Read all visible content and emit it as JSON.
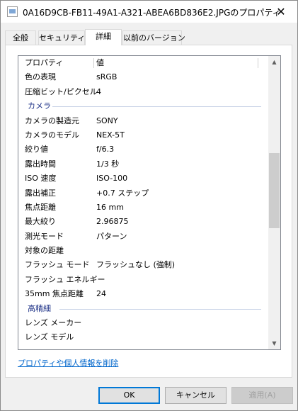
{
  "window": {
    "title": "0A16D9CB-FB11-49A1-A321-ABEA6BD836E2.JPGのプロパティ"
  },
  "tabs": [
    {
      "label": "全般"
    },
    {
      "label": "セキュリティ"
    },
    {
      "label": "詳細",
      "active": true
    },
    {
      "label": "以前のバージョン"
    }
  ],
  "details": {
    "header": {
      "name": "プロパティ",
      "value": "値"
    },
    "rows_top": [
      {
        "name": "色の表現",
        "value": "sRGB"
      },
      {
        "name": "圧縮ビット/ピクセル",
        "value": "4"
      }
    ],
    "camera_group": "カメラ",
    "camera_rows": [
      {
        "name": "カメラの製造元",
        "value": "SONY"
      },
      {
        "name": "カメラのモデル",
        "value": "NEX-5T"
      },
      {
        "name": "絞り値",
        "value": "f/6.3"
      },
      {
        "name": "露出時間",
        "value": "1/3 秒"
      },
      {
        "name": "ISO 速度",
        "value": "ISO-100"
      },
      {
        "name": "露出補正",
        "value": "+0.7 ステップ"
      },
      {
        "name": "焦点距離",
        "value": "16 mm"
      },
      {
        "name": "最大絞り",
        "value": "2.96875"
      },
      {
        "name": "測光モード",
        "value": "パターン"
      },
      {
        "name": "対象の距離",
        "value": ""
      },
      {
        "name": "フラッシュ モード",
        "value": "フラッシュなし (強制)"
      },
      {
        "name": "フラッシュ エネルギー",
        "value": ""
      },
      {
        "name": "35mm 焦点距離",
        "value": "24"
      }
    ],
    "advanced_group": "高精細",
    "advanced_rows": [
      {
        "name": "レンズ メーカー",
        "value": ""
      },
      {
        "name": "レンズ モデル",
        "value": ""
      }
    ]
  },
  "remove_link": "プロパティや個人情報を削除",
  "buttons": {
    "ok": "OK",
    "cancel": "キャンセル",
    "apply": "適用(A)"
  },
  "icons": {
    "close": "close-icon",
    "scroll_up": "scroll-up-icon",
    "scroll_down": "scroll-down-icon",
    "file": "image-file-icon"
  }
}
